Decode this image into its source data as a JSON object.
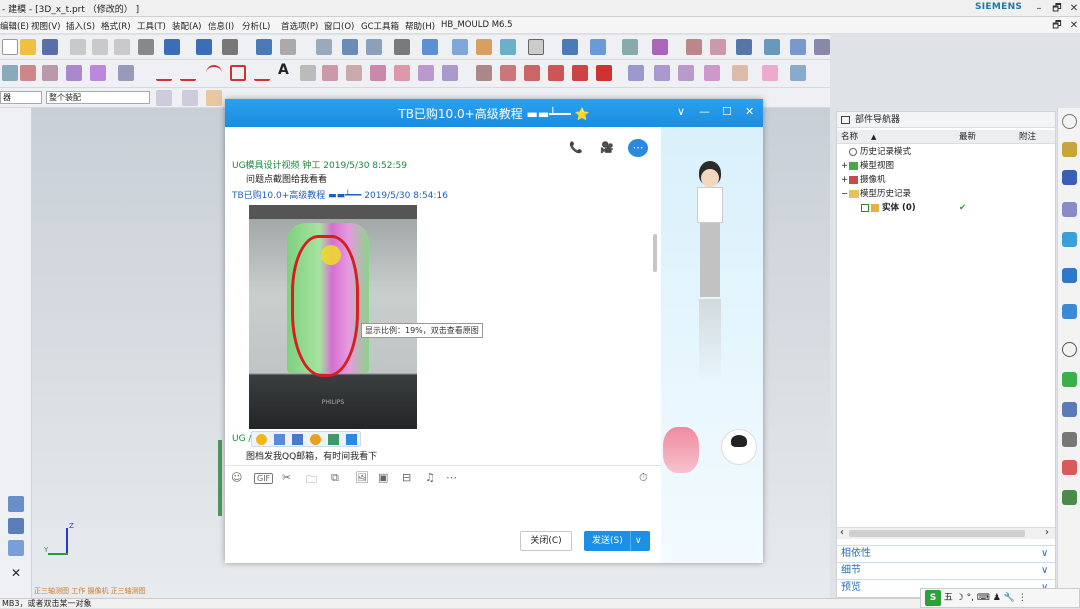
{
  "app": {
    "title": "- 建模 - [3D_x_t.prt （修改的） ]",
    "brand": "SIEMENS",
    "min": "–",
    "restore": "🗗",
    "close": "✕",
    "min2": "_",
    "restore2": "🗗",
    "close2": "✕"
  },
  "menu": [
    "编辑(E)",
    "视图(V)",
    "插入(S)",
    "格式(R)",
    "工具(T)",
    "装配(A)",
    "信息(I)",
    "分析(L)",
    "首选项(P)",
    "窗口(O)",
    "GC工具箱",
    "帮助(H)",
    "HB_MOULD M6.5"
  ],
  "filters": {
    "type_filter": "器",
    "scope_filter": "整个装配"
  },
  "viewport": {
    "axis_z": "Z",
    "axis_y": "Y",
    "bottom_caption": "正三轴测图  工作  摄像机  正三轴测图"
  },
  "status_bar": "MB3，或者双击某一对象",
  "navigator": {
    "title": "部件导航器",
    "columns": {
      "name": "名称",
      "sort": "▲",
      "latest": "最新",
      "note": "附注"
    },
    "rows": [
      {
        "label": "历史记录模式",
        "expander": "",
        "latest": ""
      },
      {
        "label": "模型视图",
        "expander": "+",
        "latest": ""
      },
      {
        "label": "摄像机",
        "expander": "+",
        "latest": ""
      },
      {
        "label": "模型历史记录",
        "expander": "−",
        "latest": ""
      },
      {
        "label": "实体 (0)",
        "expander": "",
        "latest": "✔"
      }
    ],
    "scroll_left": "‹",
    "scroll_right": "›",
    "accordion": [
      "相依性",
      "细节",
      "预览"
    ],
    "accordion_arrow": "∨"
  },
  "chat": {
    "title": "TB已购10.0+高级教程 ▬▬┷━━ ⭐",
    "header_controls": {
      "dropdown": "∨",
      "min": "—",
      "max": "☐",
      "close": "✕"
    },
    "messages": [
      {
        "sender": "UG模具设计视频 钟工 2019/5/30 8:52:59",
        "text": "问题点截图给我看看"
      },
      {
        "sender": "TB已购10.0+高级教程 ▬▬┷━━ 2019/5/30 8:54:16",
        "text": ""
      },
      {
        "sender": "UG                        /30 8:55:17",
        "text": "图档发我QQ邮箱，有时间我看下"
      }
    ],
    "photo_brand": "PHILIPS",
    "tooltip": "显示比例：19%，双击查看原图",
    "input_tools": [
      "☺",
      "GIF",
      "✂",
      "🗀",
      "⧉",
      "🖼",
      "▣",
      "⊟",
      "♫",
      "⋯"
    ],
    "history_icon": "⏱",
    "close_button": "关闭(C)",
    "send_button": "发送(S)",
    "send_arrow": "∨",
    "call_icons": [
      "📞",
      "🎥",
      "⋯"
    ]
  },
  "taskbar": {
    "ime": "S",
    "ime_text": "五 ☽ °, ⌨ ♟ 🔧 ⋮"
  }
}
